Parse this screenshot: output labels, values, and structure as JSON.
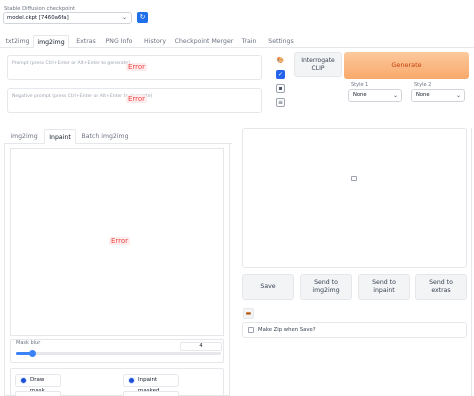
{
  "checkpoint": {
    "label": "Stable Diffusion checkpoint",
    "value": "model.ckpt [7460a6fa]",
    "refresh_icon": "refresh-icon"
  },
  "top_tabs": [
    "txt2img",
    "img2img",
    "Extras",
    "PNG Info",
    "History",
    "Checkpoint Merger",
    "Train",
    "Settings"
  ],
  "active_top_tab": "img2img",
  "prompt": {
    "placeholder": "Prompt (press Ctrl+Enter or Alt+Enter to generate)",
    "error": "Error"
  },
  "negative_prompt": {
    "placeholder": "Negative prompt (press Ctrl+Enter or Alt+Enter to generate)",
    "error": "Error"
  },
  "side_icons": [
    "paint-palette-icon",
    "checkbox-icon",
    "save-icon",
    "clipboard-icon"
  ],
  "buttons": {
    "interrogate": "Interrogate CLIP",
    "generate": "Generate"
  },
  "styles": {
    "style1_label": "Style 1",
    "style1_value": "None",
    "style2_label": "Style 2",
    "style2_value": "None"
  },
  "sub_tabs": [
    "img2img",
    "Inpaint",
    "Batch img2img"
  ],
  "active_sub_tab": "Inpaint",
  "canvas_error": "Error",
  "mask_blur": {
    "label": "Mask blur",
    "value": "4",
    "min": 0,
    "max": 64
  },
  "mask_mode": {
    "options": [
      "Draw mask",
      "Inpaint masked"
    ],
    "selected": [
      "Draw mask",
      "Inpaint masked"
    ]
  },
  "output_actions": [
    "Save",
    "Send to img2img",
    "Send to inpaint",
    "Send to extras"
  ],
  "zip_label": "Make Zip when Save?",
  "colors": {
    "accent": "#3b82f6",
    "generate_bg": "#fbb780",
    "generate_text": "#c2410c",
    "error": "#ef4444"
  }
}
